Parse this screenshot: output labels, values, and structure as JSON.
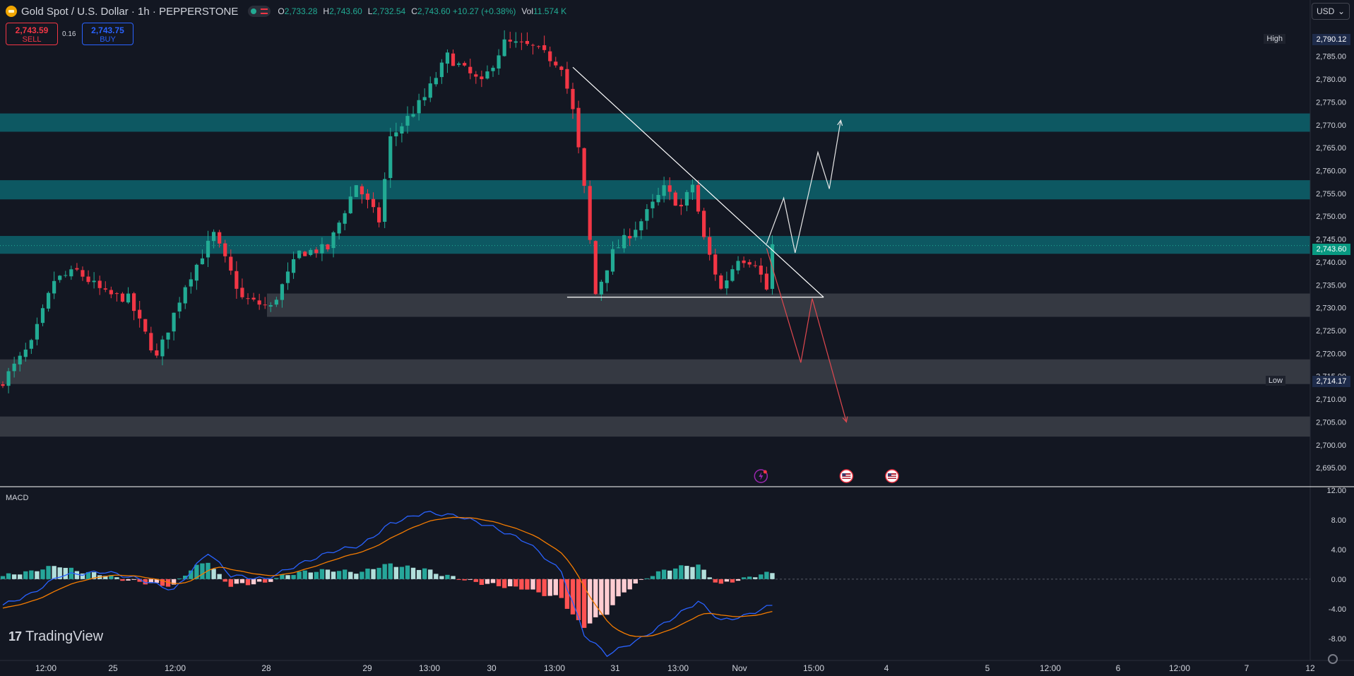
{
  "header": {
    "symbol_title": "Gold Spot / U.S. Dollar · 1h · PEPPERSTONE",
    "ohlc": [
      {
        "key": "O",
        "value": "2,733.28"
      },
      {
        "key": "H",
        "value": "2,743.60"
      },
      {
        "key": "L",
        "value": "2,732.54"
      },
      {
        "key": "C",
        "value": "2,743.60 +10.27 (+0.38%)"
      }
    ],
    "volume_label": "Vol",
    "volume_value": "11.574 K"
  },
  "trade": {
    "sell_price": "2,743.59",
    "sell_label": "SELL",
    "spread": "0.16",
    "buy_price": "2,743.75",
    "buy_label": "BUY"
  },
  "currency": {
    "selected": "USD"
  },
  "price_labels": {
    "high_label": "High",
    "high_value": "2,790.12",
    "low_label": "Low",
    "low_value": "2,714.17",
    "last_value": "2,743.60"
  },
  "indicator": {
    "name": "MACD"
  },
  "brand": {
    "name": "TradingView"
  },
  "colors": {
    "background": "#131722",
    "up": "#22ab94",
    "down": "#f23645",
    "zone_teal": "#0d5c66",
    "zone_gray": "#3a3d46",
    "macd_line": "#2962ff",
    "signal_line": "#f57c00",
    "hist_pos_strong": "#26a69a",
    "hist_pos_weak": "#b2dfdb",
    "hist_neg_strong": "#ff5252",
    "hist_neg_weak": "#ffcdd2"
  },
  "icons": [
    "gold-logo-icon",
    "lightning-event-icon",
    "us-flag-event-icon",
    "settings-gear-icon",
    "chevron-down-icon"
  ],
  "chart_data": {
    "type": "candlestick",
    "price_axis": {
      "range": [
        2691,
        2795
      ],
      "ticks": [
        "2,695.00",
        "2,700.00",
        "2,705.00",
        "2,710.00",
        "2,715.00",
        "2,720.00",
        "2,725.00",
        "2,730.00",
        "2,735.00",
        "2,740.00",
        "2,745.00",
        "2,750.00",
        "2,755.00",
        "2,760.00",
        "2,765.00",
        "2,770.00",
        "2,775.00",
        "2,780.00",
        "2,785.00"
      ]
    },
    "time_axis": {
      "labels": [
        "12:00",
        "25",
        "12:00",
        "28",
        "29",
        "13:00",
        "30",
        "13:00",
        "31",
        "13:00",
        "Nov",
        "15:00",
        "4",
        "5",
        "12:00",
        "6",
        "12:00",
        "7",
        "12"
      ]
    },
    "candles_count": 150,
    "waypoints": [
      {
        "i": 0,
        "p": 2714
      },
      {
        "i": 5,
        "p": 2722
      },
      {
        "i": 9,
        "p": 2736
      },
      {
        "i": 13,
        "p": 2738
      },
      {
        "i": 18,
        "p": 2733
      },
      {
        "i": 22,
        "p": 2732
      },
      {
        "i": 27,
        "p": 2719
      },
      {
        "i": 32,
        "p": 2735
      },
      {
        "i": 37,
        "p": 2746
      },
      {
        "i": 42,
        "p": 2732
      },
      {
        "i": 47,
        "p": 2730
      },
      {
        "i": 52,
        "p": 2742
      },
      {
        "i": 57,
        "p": 2743
      },
      {
        "i": 62,
        "p": 2757
      },
      {
        "i": 66,
        "p": 2749
      },
      {
        "i": 68,
        "p": 2767
      },
      {
        "i": 74,
        "p": 2776
      },
      {
        "i": 78,
        "p": 2785
      },
      {
        "i": 84,
        "p": 2779
      },
      {
        "i": 88,
        "p": 2788
      },
      {
        "i": 93,
        "p": 2787
      },
      {
        "i": 98,
        "p": 2783
      },
      {
        "i": 100,
        "p": 2773
      },
      {
        "i": 102,
        "p": 2756
      },
      {
        "i": 104,
        "p": 2733
      },
      {
        "i": 107,
        "p": 2742
      },
      {
        "i": 112,
        "p": 2749
      },
      {
        "i": 116,
        "p": 2756
      },
      {
        "i": 119,
        "p": 2752
      },
      {
        "i": 121,
        "p": 2757
      },
      {
        "i": 123,
        "p": 2745
      },
      {
        "i": 126,
        "p": 2734
      },
      {
        "i": 129,
        "p": 2741
      },
      {
        "i": 132,
        "p": 2740
      },
      {
        "i": 134,
        "p": 2734
      },
      {
        "i": 135,
        "p": 2743.6
      }
    ],
    "zones": [
      {
        "type": "resistance",
        "from": 2768.5,
        "to": 2772.5
      },
      {
        "type": "resistance",
        "from": 2753.7,
        "to": 2757.9
      },
      {
        "type": "resistance",
        "from": 2741.8,
        "to": 2745.7
      },
      {
        "type": "support",
        "from": 2728.0,
        "to": 2733.1
      },
      {
        "type": "support",
        "from": 2713.3,
        "to": 2718.7
      },
      {
        "type": "support",
        "from": 2701.8,
        "to": 2706.2
      }
    ],
    "trendlines": [
      {
        "name": "descending-resistance",
        "points": [
          [
            100,
            2782.6
          ],
          [
            144,
            2732.3
          ]
        ]
      },
      {
        "name": "horizontal-support",
        "points": [
          [
            99,
            2732.3
          ],
          [
            144,
            2732.3
          ]
        ]
      }
    ],
    "scenarios": [
      {
        "name": "bullish",
        "path": [
          [
            134,
            2744
          ],
          [
            137,
            2754
          ],
          [
            139,
            2742
          ],
          [
            143,
            2764
          ],
          [
            145,
            2756
          ],
          [
            147,
            2771
          ]
        ]
      },
      {
        "name": "bearish",
        "path": [
          [
            134,
            2743
          ],
          [
            140,
            2718
          ],
          [
            142,
            2732
          ],
          [
            148,
            2705
          ]
        ]
      }
    ],
    "events": [
      {
        "i": 133,
        "kind": "lightning"
      },
      {
        "i": 148,
        "kind": "us-flag"
      },
      {
        "i": 156,
        "kind": "us-flag"
      }
    ],
    "macd": {
      "axis_ticks": [
        "12.00",
        "8.00",
        "4.00",
        "0.00",
        "-4.00",
        "-8.00"
      ],
      "range": [
        -10.5,
        12
      ],
      "macd_waypoints": [
        {
          "i": 0,
          "v": -3.5
        },
        {
          "i": 5,
          "v": -2
        },
        {
          "i": 10,
          "v": 0.5
        },
        {
          "i": 18,
          "v": 1
        },
        {
          "i": 24,
          "v": 0
        },
        {
          "i": 30,
          "v": -1.5
        },
        {
          "i": 36,
          "v": 3.6
        },
        {
          "i": 40,
          "v": 0.5
        },
        {
          "i": 46,
          "v": 0
        },
        {
          "i": 52,
          "v": 2
        },
        {
          "i": 58,
          "v": 3.8
        },
        {
          "i": 63,
          "v": 4.6
        },
        {
          "i": 68,
          "v": 7.5
        },
        {
          "i": 74,
          "v": 9
        },
        {
          "i": 80,
          "v": 8.5
        },
        {
          "i": 86,
          "v": 7
        },
        {
          "i": 92,
          "v": 5
        },
        {
          "i": 98,
          "v": 1
        },
        {
          "i": 102,
          "v": -7.5
        },
        {
          "i": 106,
          "v": -10.2
        },
        {
          "i": 112,
          "v": -8
        },
        {
          "i": 118,
          "v": -5
        },
        {
          "i": 122,
          "v": -3
        },
        {
          "i": 126,
          "v": -5.6
        },
        {
          "i": 130,
          "v": -5
        },
        {
          "i": 135,
          "v": -3.5
        }
      ]
    }
  }
}
